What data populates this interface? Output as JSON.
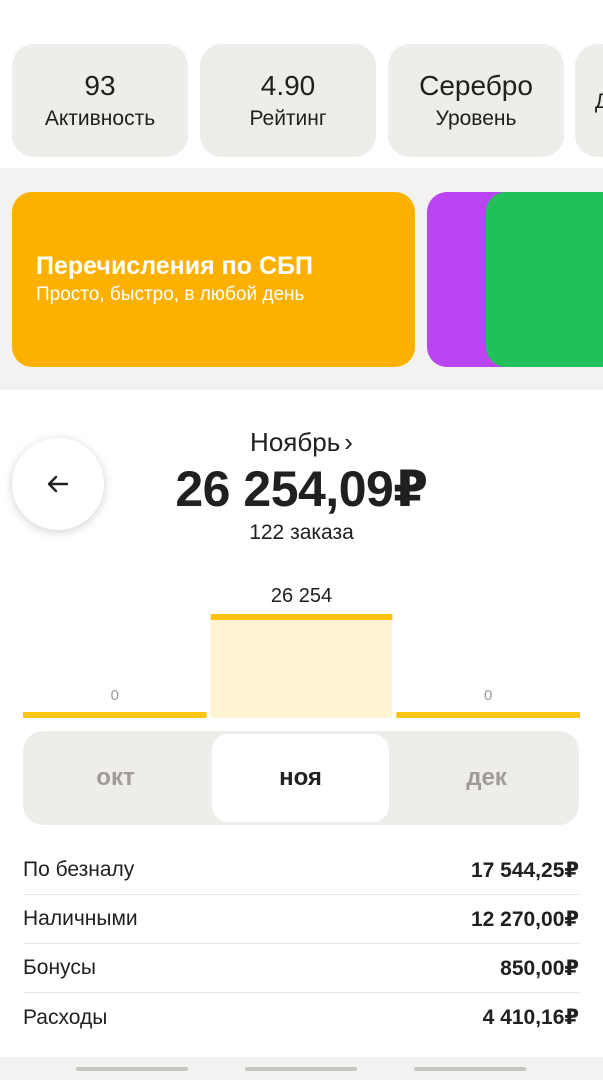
{
  "stats": [
    {
      "value": "93",
      "label": "Активность"
    },
    {
      "value": "4.90",
      "label": "Рейтинг"
    },
    {
      "value": "Серебро",
      "label": "Уровень"
    },
    {
      "value": "",
      "label": "Д"
    }
  ],
  "banner": {
    "title": "Перечисления по СБП",
    "subtitle": "Просто, быстро, в любой день",
    "color": "#fcb100"
  },
  "summary": {
    "month": "Ноябрь",
    "chevron": "›",
    "total": "26 254,09₽",
    "orders": "122 заказа"
  },
  "chart_data": {
    "type": "bar",
    "categories": [
      "окт",
      "ноя",
      "дек"
    ],
    "values": [
      0,
      26254,
      0
    ],
    "data_labels": [
      "0",
      "26 254",
      "0"
    ],
    "selected_index": 1,
    "ylim": [
      0,
      26254
    ],
    "bar_color": "#fcc30f",
    "fill_color": "#fff3d2"
  },
  "month_switcher": {
    "tabs": [
      {
        "label": "окт"
      },
      {
        "label": "ноя"
      },
      {
        "label": "дек"
      }
    ],
    "active": 1
  },
  "breakdown": [
    {
      "label": "По безналу",
      "value": "17 544,25₽"
    },
    {
      "label": "Наличными",
      "value": "12 270,00₽"
    },
    {
      "label": "Бонусы",
      "value": "850,00₽"
    },
    {
      "label": "Расходы",
      "value": "4 410,16₽"
    }
  ],
  "icons": {
    "back": "arrow-left-icon"
  }
}
